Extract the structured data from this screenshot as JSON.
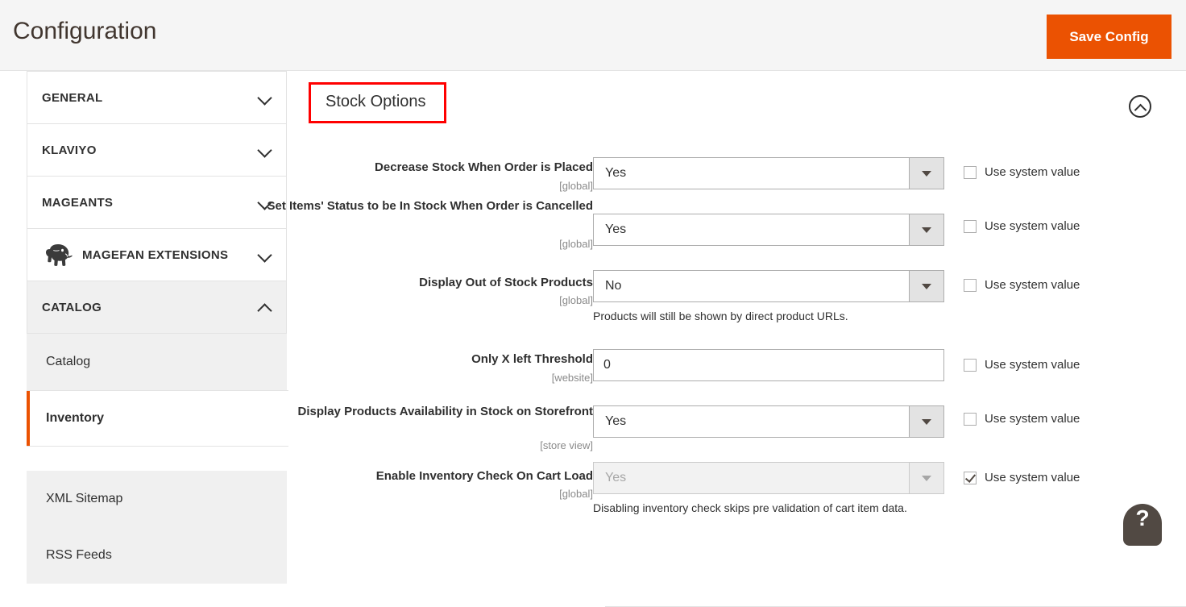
{
  "header": {
    "title": "Configuration",
    "save_label": "Save Config"
  },
  "sidebar": {
    "sections": [
      {
        "label": "GENERAL",
        "icon": "chevron-down-icon",
        "expanded": false
      },
      {
        "label": "KLAVIYO",
        "icon": "chevron-down-icon",
        "expanded": false
      },
      {
        "label": "MAGEANTS",
        "icon": "chevron-down-icon",
        "expanded": false
      },
      {
        "label": "MAGEFAN EXTENSIONS",
        "icon": "chevron-down-icon",
        "expanded": false,
        "badge_icon": "mammoth-icon"
      },
      {
        "label": "CATALOG",
        "icon": "chevron-up-icon",
        "expanded": true
      }
    ],
    "sub_items": [
      {
        "label": "Catalog",
        "active": false
      },
      {
        "label": "Inventory",
        "active": true
      },
      {
        "label": "XML Sitemap",
        "active": false
      },
      {
        "label": "RSS Feeds",
        "active": false
      }
    ],
    "active_accent": "#eb5202"
  },
  "content": {
    "section_title": "Stock Options",
    "section_title_highlight_color": "#ff0000",
    "collapse_icon": "chevron-up-circle-icon",
    "use_system_value_label": "Use system value",
    "rows": [
      {
        "label": "Decrease Stock When Order is Placed",
        "scope": "[global]",
        "control": "select",
        "value": "Yes",
        "disabled": false,
        "note": "",
        "use_system_value": false
      },
      {
        "label": "Set Items' Status to be In Stock When Order is Cancelled",
        "scope": "[global]",
        "control": "select",
        "value": "Yes",
        "disabled": false,
        "note": "",
        "use_system_value": false
      },
      {
        "label": "Display Out of Stock Products",
        "scope": "[global]",
        "control": "select",
        "value": "No",
        "disabled": false,
        "note": "Products will still be shown by direct product URLs.",
        "use_system_value": false
      },
      {
        "label": "Only X left Threshold",
        "scope": "[website]",
        "control": "text",
        "value": "0",
        "disabled": false,
        "note": "",
        "use_system_value": false
      },
      {
        "label": "Display Products Availability in Stock on Storefront",
        "scope": "[store view]",
        "control": "select",
        "value": "Yes",
        "disabled": false,
        "note": "",
        "use_system_value": false
      },
      {
        "label": "Enable Inventory Check On Cart Load",
        "scope": "[global]",
        "control": "select",
        "value": "Yes",
        "disabled": true,
        "note": "Disabling inventory check skips pre validation of cart item data.",
        "use_system_value": true
      }
    ]
  },
  "help": {
    "glyph": "?"
  }
}
